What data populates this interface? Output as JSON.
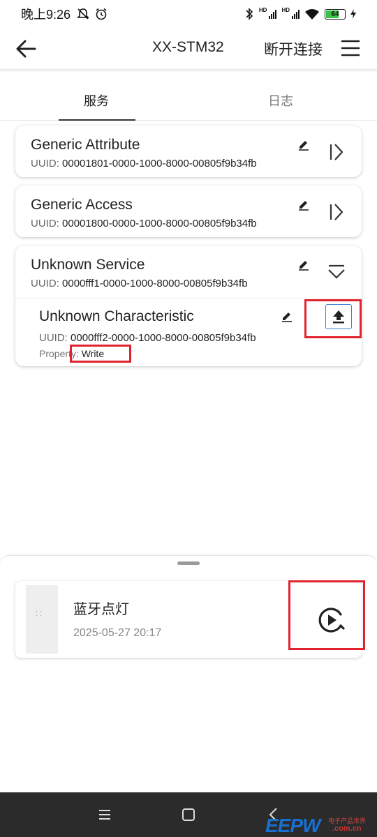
{
  "status_bar": {
    "time": "晚上9:26",
    "battery": "64",
    "hd_1": "HD",
    "hd_2": "HD"
  },
  "app_bar": {
    "back_icon": "arrow-left-icon",
    "title": "XX-STM32",
    "disconnect_label": "断开连接",
    "menu_icon": "hamburger-menu-icon"
  },
  "tabs": [
    {
      "label": "服务",
      "active": true
    },
    {
      "label": "日志",
      "active": false
    }
  ],
  "services": [
    {
      "name": "Generic Attribute",
      "uuid_label": "UUID:",
      "uuid": "00001801-0000-1000-8000-00805f9b34fb",
      "expanded": false
    },
    {
      "name": "Generic Access",
      "uuid_label": "UUID:",
      "uuid": "00001800-0000-1000-8000-00805f9b34fb",
      "expanded": false
    },
    {
      "name": "Unknown Service",
      "uuid_label": "UUID:",
      "uuid": "0000fff1-0000-1000-8000-00805f9b34fb",
      "expanded": true,
      "characteristic": {
        "name": "Unknown Characteristic",
        "uuid_label": "UUID:",
        "uuid": "0000fff2-0000-1000-8000-00805f9b34fb",
        "property_label": "Property:",
        "property": "Write"
      }
    }
  ],
  "macro_sheet": {
    "item": {
      "thumb_text": "⁚ ⁚",
      "name": "蓝牙点灯",
      "date": "2025-05-27 20:17"
    }
  },
  "watermark": {
    "logo": "EEPW",
    "tagline": "电子产品世界",
    "url": ".com.cn"
  },
  "colors": {
    "accent_blue": "#3f7fd1",
    "annotation_red": "#e0232e",
    "navbar": "#2b2b2b"
  }
}
